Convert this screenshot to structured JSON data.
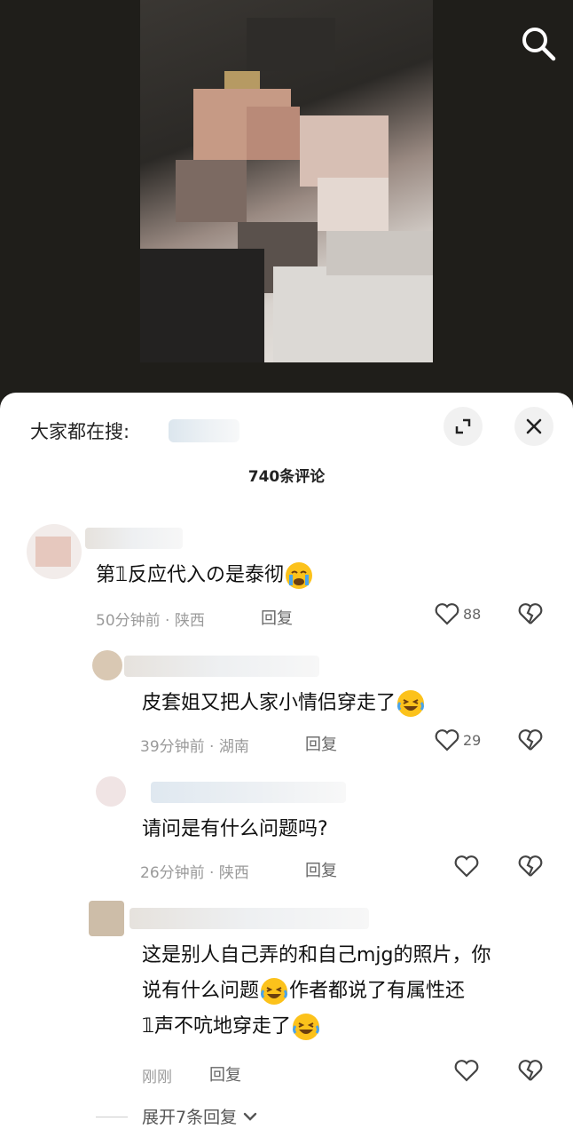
{
  "header": {
    "search_hint_label": "大家都在搜:",
    "comment_count_title": "740条评论"
  },
  "comments": [
    {
      "text": "第𝟙反应代入の是泰彻",
      "time": "50分钟前",
      "location": "陕西",
      "reply_label": "回复",
      "likes": "88"
    },
    {
      "text": "皮套姐又把人家小情侣穿走了",
      "time": "39分钟前",
      "location": "湖南",
      "reply_label": "回复",
      "likes": "29"
    },
    {
      "text": "请问是有什么问题吗?",
      "time": "26分钟前",
      "location": "陕西",
      "reply_label": "回复",
      "likes": ""
    },
    {
      "text_line1": "这是别人自己弄的和自己mjg的照片，你",
      "text_line2": "说有什么问题",
      "text_line2b": "作者都说了有属性还",
      "text_line3": "𝟙声不吭地穿走了",
      "time": "刚刚",
      "reply_label": "回复",
      "likes": ""
    }
  ],
  "expand_replies_label": "展开7条回复",
  "icons": {
    "search": "search-icon",
    "expand": "expand-icon",
    "close": "close-icon",
    "like": "heart-icon",
    "dislike": "broken-heart-icon",
    "emoji_cry": "crying-emoji-icon",
    "emoji_laugh": "laughing-tears-emoji-icon"
  },
  "colors": {
    "background_dark": "#1e1d19",
    "sheet": "#ffffff",
    "meta_text": "#9a9a9a"
  }
}
